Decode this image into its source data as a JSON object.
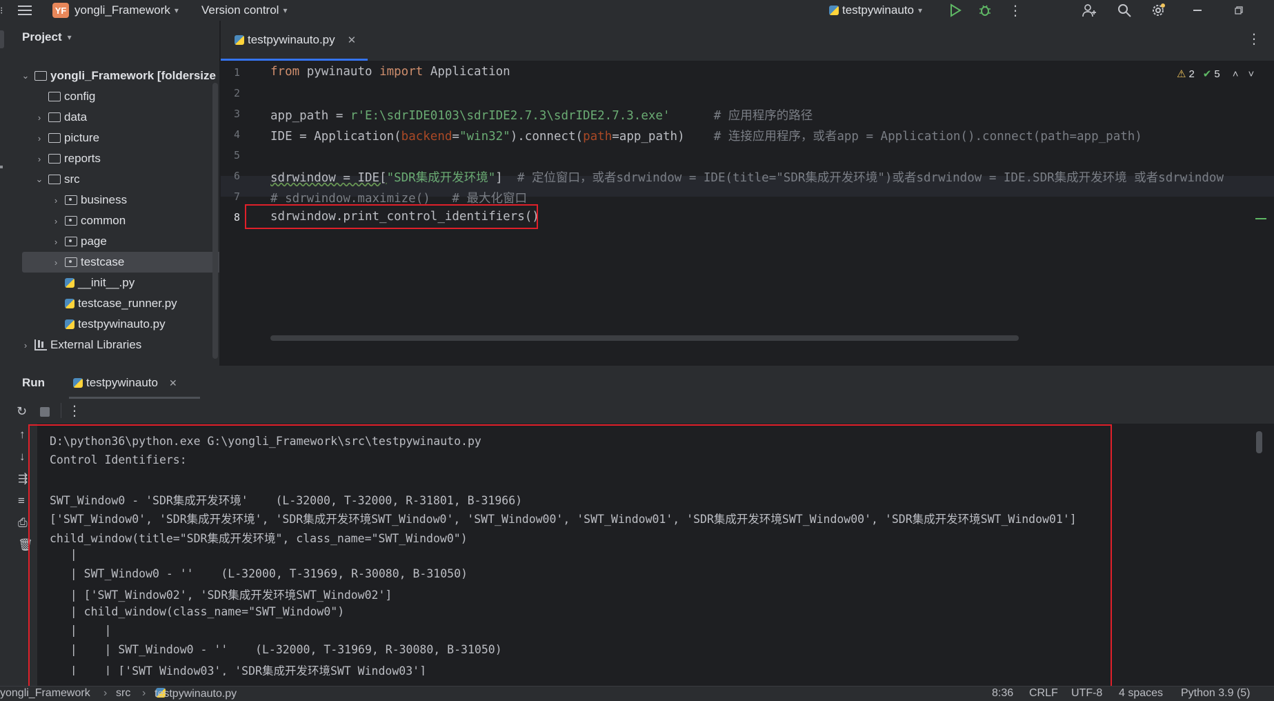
{
  "titlebar": {
    "badge": "YF",
    "project_name": "yongli_Framework",
    "vcs_label": "Version control",
    "run_config": "testpywinauto"
  },
  "project_panel": {
    "title": "Project",
    "items": [
      {
        "label": "yongli_Framework [foldersize",
        "type": "folder",
        "expanded": true
      },
      {
        "label": "config",
        "type": "folder"
      },
      {
        "label": "data",
        "type": "folder"
      },
      {
        "label": "picture",
        "type": "folder"
      },
      {
        "label": "reports",
        "type": "folder"
      },
      {
        "label": "src",
        "type": "folder",
        "expanded": true
      },
      {
        "label": "business",
        "type": "package"
      },
      {
        "label": "common",
        "type": "package"
      },
      {
        "label": "page",
        "type": "package"
      },
      {
        "label": "testcase",
        "type": "package",
        "selected": true
      },
      {
        "label": "__init__.py",
        "type": "python"
      },
      {
        "label": "testcase_runner.py",
        "type": "python"
      },
      {
        "label": "testpywinauto.py",
        "type": "python"
      },
      {
        "label": "External Libraries",
        "type": "library"
      }
    ]
  },
  "editor": {
    "tab_label": "testpywinauto.py",
    "warnings": "2",
    "checks": "5",
    "line_numbers": [
      "1",
      "2",
      "3",
      "4",
      "5",
      "6",
      "7",
      "8"
    ],
    "code": {
      "l1_from": "from",
      "l1_mod": " pywinauto ",
      "l1_import": "import",
      "l1_rest": " Application",
      "l3_a": "app_path = ",
      "l3_str": "r'E:\\sdrIDE0103\\sdrIDE2.7.3\\sdrIDE2.7.3.exe'",
      "l3_cm": "      # 应用程序的路径",
      "l4_a": "IDE = Application(",
      "l4_p1": "backend",
      "l4_b": "=",
      "l4_s1": "\"win32\"",
      "l4_c": ").connect(",
      "l4_p2": "path",
      "l4_d": "=app_path)",
      "l4_cm": "    # 连接应用程序，或者app = Application().connect(path=app_path)",
      "l6_a": "sdrwindow = IDE[",
      "l6_s": "\"SDR集成开发环境\"",
      "l6_b": "]",
      "l6_cm": "  # 定位窗口，或者sdrwindow = IDE(title=\"SDR集成开发环境\")或者sdrwindow = IDE.SDR集成开发环境 或者sdrwindow",
      "l7": "# sdrwindow.maximize()   # 最大化窗口",
      "l8": "sdrwindow.print_control_identifiers()"
    }
  },
  "run_panel": {
    "title": "Run",
    "tab_label": "testpywinauto",
    "console": [
      "D:\\python36\\python.exe G:\\yongli_Framework\\src\\testpywinauto.py",
      "Control Identifiers:",
      "",
      "SWT_Window0 - 'SDR集成开发环境'    (L-32000, T-32000, R-31801, B-31966)",
      "['SWT_Window0', 'SDR集成开发环境', 'SDR集成开发环境SWT_Window0', 'SWT_Window00', 'SWT_Window01', 'SDR集成开发环境SWT_Window00', 'SDR集成开发环境SWT_Window01']",
      "child_window(title=\"SDR集成开发环境\", class_name=\"SWT_Window0\")",
      "   |",
      "   | SWT_Window0 - ''    (L-32000, T-31969, R-30080, B-31050)",
      "   | ['SWT_Window02', 'SDR集成开发环境SWT_Window02']",
      "   | child_window(class_name=\"SWT_Window0\")",
      "   |    |",
      "   |    | SWT_Window0 - ''    (L-32000, T-31969, R-30080, B-31050)",
      "   |    | ['SWT_Window03', 'SDR集成开发环境SWT_Window03']"
    ]
  },
  "statusbar": {
    "breadcrumb_root": "yongli_Framework",
    "breadcrumb_src": "src",
    "breadcrumb_file": "testpywinauto.py",
    "position": "8:36",
    "line_sep": "CRLF",
    "encoding": "UTF-8",
    "indent": "4 spaces",
    "interpreter": "Python 3.9 (5)"
  },
  "colors": {
    "accent": "#3574f0",
    "highlight_box": "#e0202a",
    "keyword": "#cf8e6d",
    "string": "#6aab73",
    "comment": "#7a7e85"
  }
}
